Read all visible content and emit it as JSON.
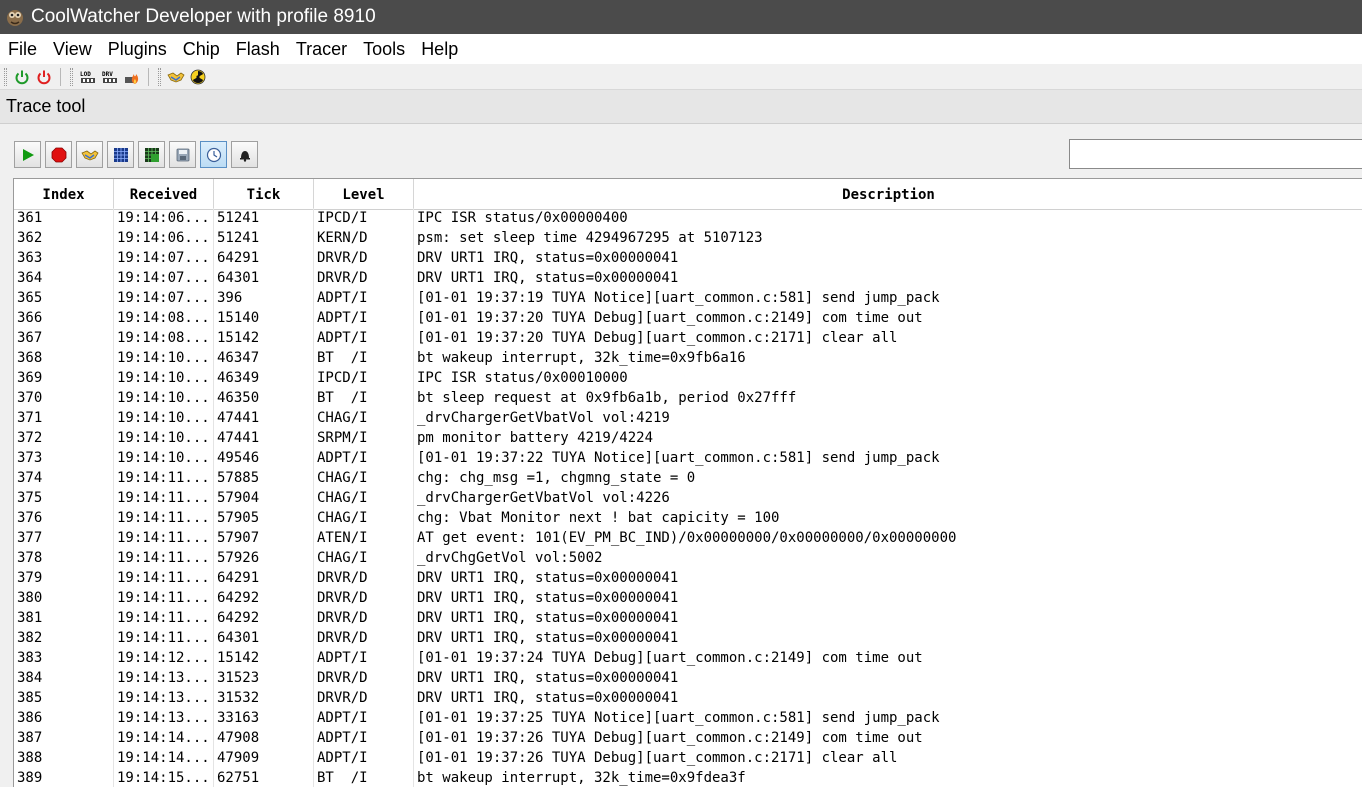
{
  "window": {
    "title": "CoolWatcher Developer with profile 8910"
  },
  "menu": [
    "File",
    "View",
    "Plugins",
    "Chip",
    "Flash",
    "Tracer",
    "Tools",
    "Help"
  ],
  "toolbar": {
    "icons": [
      "power-on-icon",
      "power-off-icon",
      "lod-icon",
      "drv-icon",
      "flash-fire-icon",
      "handshake-icon",
      "radiation-icon"
    ],
    "lod_label": "LOD",
    "drv_label": "DRV"
  },
  "panel": {
    "title": "Trace tool"
  },
  "trace_toolbar": {
    "buttons": [
      "play",
      "stop",
      "handshake",
      "grid",
      "grid-filter",
      "save",
      "clock",
      "bell"
    ],
    "search": {
      "value": "",
      "placeholder": ""
    }
  },
  "table": {
    "columns": [
      "Index",
      "Received",
      "Tick",
      "Level",
      "Description"
    ],
    "rows": [
      [
        "361",
        "19:14:06....",
        "51241",
        "IPCD/I",
        "IPC ISR status/0x00000400"
      ],
      [
        "362",
        "19:14:06....",
        "51241",
        "KERN/D",
        "psm: set sleep time 4294967295 at 5107123"
      ],
      [
        "363",
        "19:14:07....",
        "64291",
        "DRVR/D",
        "DRV URT1 IRQ, status=0x00000041"
      ],
      [
        "364",
        "19:14:07....",
        "64301",
        "DRVR/D",
        "DRV URT1 IRQ, status=0x00000041"
      ],
      [
        "365",
        "19:14:07....",
        "396",
        "ADPT/I",
        "[01-01 19:37:19 TUYA Notice][uart_common.c:581] send jump_pack"
      ],
      [
        "366",
        "19:14:08....",
        "15140",
        "ADPT/I",
        "[01-01 19:37:20 TUYA Debug][uart_common.c:2149] com time out"
      ],
      [
        "367",
        "19:14:08....",
        "15142",
        "ADPT/I",
        "[01-01 19:37:20 TUYA Debug][uart_common.c:2171] clear all"
      ],
      [
        "368",
        "19:14:10....",
        "46347",
        "BT  /I",
        "bt wakeup interrupt, 32k_time=0x9fb6a16"
      ],
      [
        "369",
        "19:14:10....",
        "46349",
        "IPCD/I",
        "IPC ISR status/0x00010000"
      ],
      [
        "370",
        "19:14:10....",
        "46350",
        "BT  /I",
        "bt sleep request at 0x9fb6a1b, period 0x27fff"
      ],
      [
        "371",
        "19:14:10....",
        "47441",
        "CHAG/I",
        "_drvChargerGetVbatVol vol:4219"
      ],
      [
        "372",
        "19:14:10....",
        "47441",
        "SRPM/I",
        "pm monitor battery 4219/4224"
      ],
      [
        "373",
        "19:14:10....",
        "49546",
        "ADPT/I",
        "[01-01 19:37:22 TUYA Notice][uart_common.c:581] send jump_pack"
      ],
      [
        "374",
        "19:14:11....",
        "57885",
        "CHAG/I",
        "chg: chg_msg =1, chgmng_state = 0"
      ],
      [
        "375",
        "19:14:11....",
        "57904",
        "CHAG/I",
        "_drvChargerGetVbatVol vol:4226"
      ],
      [
        "376",
        "19:14:11....",
        "57905",
        "CHAG/I",
        "chg: Vbat Monitor next ! bat capicity = 100"
      ],
      [
        "377",
        "19:14:11....",
        "57907",
        "ATEN/I",
        "AT get event: 101(EV_PM_BC_IND)/0x00000000/0x00000000/0x00000000"
      ],
      [
        "378",
        "19:14:11....",
        "57926",
        "CHAG/I",
        "_drvChgGetVol vol:5002"
      ],
      [
        "379",
        "19:14:11....",
        "64291",
        "DRVR/D",
        "DRV URT1 IRQ, status=0x00000041"
      ],
      [
        "380",
        "19:14:11....",
        "64292",
        "DRVR/D",
        "DRV URT1 IRQ, status=0x00000041"
      ],
      [
        "381",
        "19:14:11....",
        "64292",
        "DRVR/D",
        "DRV URT1 IRQ, status=0x00000041"
      ],
      [
        "382",
        "19:14:11....",
        "64301",
        "DRVR/D",
        "DRV URT1 IRQ, status=0x00000041"
      ],
      [
        "383",
        "19:14:12....",
        "15142",
        "ADPT/I",
        "[01-01 19:37:24 TUYA Debug][uart_common.c:2149] com time out"
      ],
      [
        "384",
        "19:14:13....",
        "31523",
        "DRVR/D",
        "DRV URT1 IRQ, status=0x00000041"
      ],
      [
        "385",
        "19:14:13....",
        "31532",
        "DRVR/D",
        "DRV URT1 IRQ, status=0x00000041"
      ],
      [
        "386",
        "19:14:13....",
        "33163",
        "ADPT/I",
        "[01-01 19:37:25 TUYA Notice][uart_common.c:581] send jump_pack"
      ],
      [
        "387",
        "19:14:14....",
        "47908",
        "ADPT/I",
        "[01-01 19:37:26 TUYA Debug][uart_common.c:2149] com time out"
      ],
      [
        "388",
        "19:14:14....",
        "47909",
        "ADPT/I",
        "[01-01 19:37:26 TUYA Debug][uart_common.c:2171] clear all"
      ],
      [
        "389",
        "19:14:15....",
        "62751",
        "BT  /I",
        "bt wakeup interrupt, 32k_time=0x9fdea3f"
      ]
    ]
  }
}
